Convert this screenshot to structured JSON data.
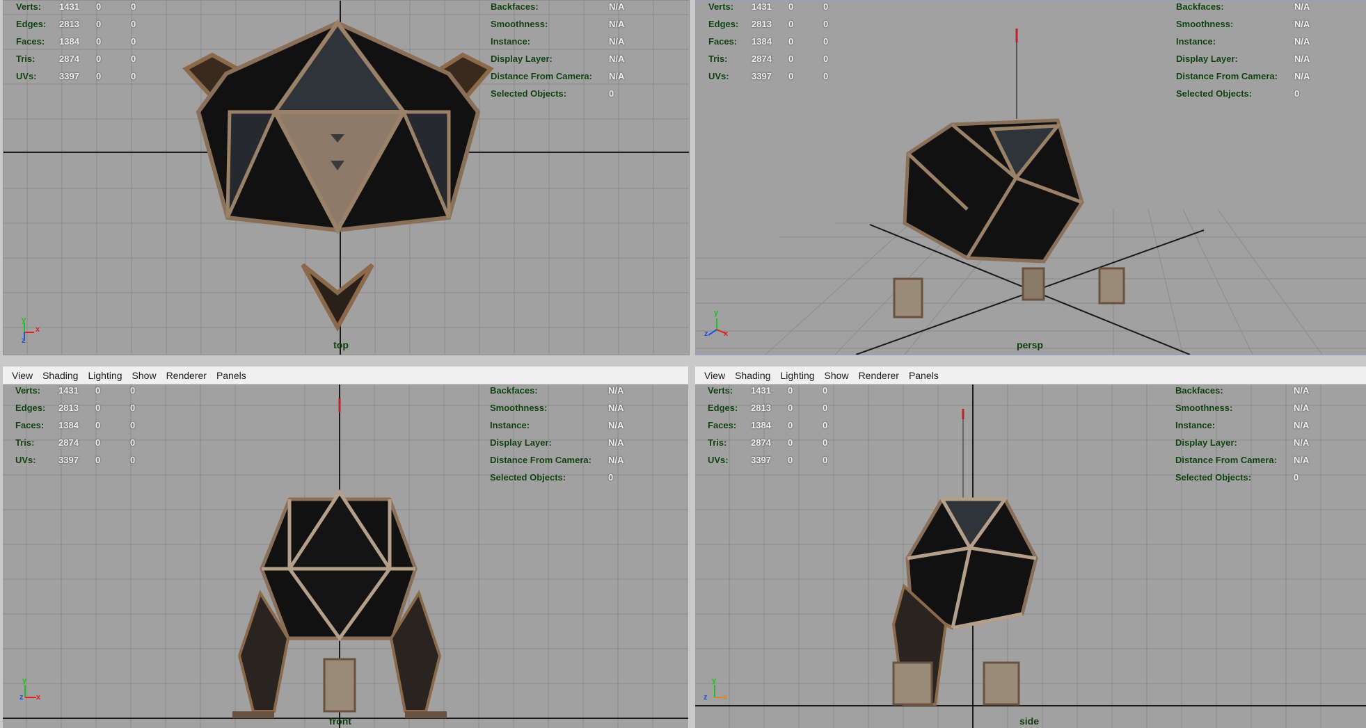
{
  "menu": [
    "View",
    "Shading",
    "Lighting",
    "Show",
    "Renderer",
    "Panels"
  ],
  "hud_left": [
    {
      "label": "Verts:",
      "v1": "1431",
      "v2": "0",
      "v3": "0"
    },
    {
      "label": "Edges:",
      "v1": "2813",
      "v2": "0",
      "v3": "0"
    },
    {
      "label": "Faces:",
      "v1": "1384",
      "v2": "0",
      "v3": "0"
    },
    {
      "label": "Tris:",
      "v1": "2874",
      "v2": "0",
      "v3": "0"
    },
    {
      "label": "UVs:",
      "v1": "3397",
      "v2": "0",
      "v3": "0"
    }
  ],
  "hud_right": [
    {
      "label": "Backfaces:",
      "value": "N/A"
    },
    {
      "label": "Smoothness:",
      "value": "N/A"
    },
    {
      "label": "Instance:",
      "value": "N/A"
    },
    {
      "label": "Display Layer:",
      "value": "N/A"
    },
    {
      "label": "Distance From Camera:",
      "value": "N/A"
    },
    {
      "label": "Selected Objects:",
      "value": "0"
    }
  ],
  "panes": {
    "top": {
      "camera": "top",
      "axes": [
        "y",
        "x",
        "z"
      ]
    },
    "persp": {
      "camera": "persp",
      "axes": [
        "y",
        "z",
        "x"
      ]
    },
    "front": {
      "camera": "front",
      "axes": [
        "y",
        "z",
        "x"
      ]
    },
    "side": {
      "camera": "side",
      "axes": [
        "y",
        "z",
        "x"
      ]
    }
  },
  "colors": {
    "viewport_bg": "#a1a1a1",
    "grid": "#8a8a8a",
    "axis_line": "#1a1a1a",
    "hud_label": "#0d3f0d",
    "hud_value": "#f0f0f0",
    "axis_x": "#e02020",
    "axis_y": "#20c020",
    "axis_z": "#2050e0",
    "model_dark": "#111111",
    "model_frame": "#8a7058"
  }
}
